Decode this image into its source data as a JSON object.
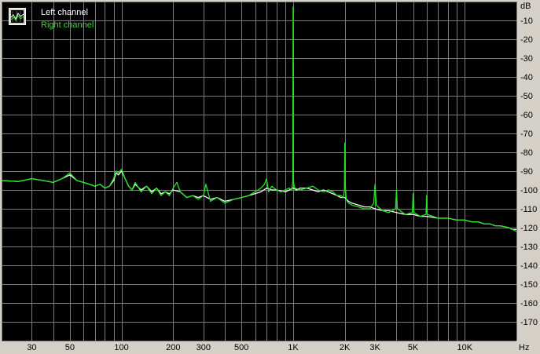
{
  "colors": {
    "background": "#000000",
    "frame": "#d4d0c8",
    "grid": "#7a7a7a",
    "left_channel": "#ffffff",
    "right_channel": "#22e622"
  },
  "legend": {
    "icon": "spectrum-icon",
    "placement": "top-left"
  },
  "chart_data": {
    "type": "line",
    "title": "",
    "xlabel": "",
    "ylabel": "",
    "x_unit": "Hz",
    "y_unit": "dB",
    "x_scale": "log",
    "xlim": [
      20,
      20000
    ],
    "ylim": [
      -180,
      0
    ],
    "grid": true,
    "x_ticks": [
      {
        "value": 30,
        "label": "30"
      },
      {
        "value": 50,
        "label": "50"
      },
      {
        "value": 100,
        "label": "100"
      },
      {
        "value": 200,
        "label": "200"
      },
      {
        "value": 300,
        "label": "300"
      },
      {
        "value": 500,
        "label": "500"
      },
      {
        "value": 1000,
        "label": "1K"
      },
      {
        "value": 2000,
        "label": "2K"
      },
      {
        "value": 3000,
        "label": "3K"
      },
      {
        "value": 5000,
        "label": "5K"
      },
      {
        "value": 10000,
        "label": "10K"
      }
    ],
    "y_ticks": [
      {
        "value": -10,
        "label": "-10"
      },
      {
        "value": -20,
        "label": "-20"
      },
      {
        "value": -30,
        "label": "-30"
      },
      {
        "value": -40,
        "label": "-40"
      },
      {
        "value": -50,
        "label": "-50"
      },
      {
        "value": -60,
        "label": "-60"
      },
      {
        "value": -70,
        "label": "-70"
      },
      {
        "value": -80,
        "label": "-80"
      },
      {
        "value": -90,
        "label": "-90"
      },
      {
        "value": -100,
        "label": "-100"
      },
      {
        "value": -110,
        "label": "-110"
      },
      {
        "value": -120,
        "label": "-120"
      },
      {
        "value": -130,
        "label": "-130"
      },
      {
        "value": -140,
        "label": "-140"
      },
      {
        "value": -150,
        "label": "-150"
      },
      {
        "value": -160,
        "label": "-160"
      },
      {
        "value": -170,
        "label": "-170"
      }
    ],
    "series": [
      {
        "name": "Left channel",
        "color": "#ffffff",
        "x": [
          20,
          25,
          30,
          35,
          40,
          45,
          50,
          55,
          60,
          65,
          70,
          75,
          80,
          85,
          90,
          93,
          96,
          100,
          105,
          110,
          115,
          120,
          130,
          140,
          150,
          160,
          170,
          180,
          190,
          200,
          220,
          240,
          260,
          280,
          300,
          330,
          360,
          400,
          450,
          500,
          550,
          600,
          650,
          700,
          750,
          800,
          900,
          950,
          1000,
          1050,
          1100,
          1200,
          1300,
          1400,
          1500,
          1600,
          1700,
          1800,
          1900,
          2000,
          2100,
          2200,
          2400,
          2600,
          2800,
          3000,
          3300,
          3600,
          4000,
          4500,
          5000,
          5500,
          6000,
          7000,
          8000,
          9000,
          10000,
          11000,
          12000,
          13000,
          14000,
          15000,
          16000,
          17000,
          18000,
          19000,
          20000
        ],
        "y": [
          -95,
          -95.5,
          -94,
          -95,
          -96,
          -94,
          -92,
          -95,
          -96,
          -97,
          -98,
          -97,
          -99,
          -98,
          -95,
          -91,
          -92,
          -90,
          -94,
          -98,
          -100,
          -97,
          -100,
          -98,
          -101,
          -99,
          -102,
          -101,
          -102,
          -100,
          -101,
          -104,
          -103,
          -104,
          -103,
          -105,
          -104,
          -106,
          -105,
          -104,
          -103,
          -102,
          -101,
          -99,
          -100,
          -100,
          -101,
          -100,
          -99,
          -100,
          -99,
          -99,
          -100,
          -101,
          -100,
          -101,
          -102,
          -103,
          -104,
          -104,
          -106,
          -107,
          -108,
          -109,
          -109,
          -110,
          -111,
          -111,
          -112,
          -113,
          -113,
          -114,
          -114,
          -115,
          -115,
          -116,
          -116,
          -117,
          -117,
          -118,
          -118,
          -119,
          -119,
          -119.5,
          -120,
          -121,
          -121
        ]
      },
      {
        "name": "Right channel",
        "color": "#22e622",
        "x": [
          20,
          25,
          30,
          35,
          40,
          45,
          50,
          55,
          60,
          65,
          70,
          75,
          80,
          85,
          90,
          93,
          96,
          100,
          105,
          110,
          115,
          120,
          130,
          140,
          150,
          160,
          170,
          180,
          190,
          200,
          210,
          220,
          240,
          260,
          280,
          300,
          310,
          330,
          360,
          400,
          450,
          500,
          550,
          600,
          650,
          680,
          700,
          720,
          750,
          800,
          850,
          900,
          950,
          980,
          995,
          1000,
          1005,
          1020,
          1100,
          1200,
          1300,
          1400,
          1500,
          1600,
          1700,
          1800,
          1900,
          1960,
          1990,
          2000,
          2010,
          2040,
          2100,
          2200,
          2400,
          2600,
          2800,
          2950,
          3000,
          3050,
          3300,
          3600,
          3950,
          4000,
          4050,
          4500,
          4950,
          5000,
          5050,
          5500,
          5950,
          6000,
          6050,
          7000,
          8000,
          9000,
          10000,
          11000,
          12000,
          13000,
          14000,
          15000,
          16000,
          17000,
          18000,
          19000,
          20000
        ],
        "y": [
          -95,
          -95.5,
          -94,
          -95,
          -96,
          -94,
          -91,
          -95,
          -96,
          -97,
          -98,
          -97,
          -99,
          -98,
          -94,
          -90,
          -91,
          -89,
          -94,
          -98,
          -100,
          -96,
          -101,
          -98,
          -102,
          -99,
          -103,
          -101,
          -103,
          -99,
          -96,
          -101,
          -104,
          -103,
          -105,
          -103,
          -97,
          -106,
          -104,
          -107,
          -105,
          -104,
          -103,
          -101,
          -99,
          -97,
          -94,
          -101,
          -98,
          -100,
          -101,
          -100,
          -99,
          -100,
          -96,
          -3,
          -96,
          -99,
          -100,
          -99,
          -98,
          -100,
          -101,
          -100,
          -101,
          -103,
          -103,
          -104,
          -100,
          -75,
          -96,
          -105,
          -107,
          -108,
          -109,
          -110,
          -110,
          -107,
          -97,
          -108,
          -111,
          -112,
          -110,
          -100,
          -110,
          -113,
          -112,
          -102,
          -112,
          -114,
          -113,
          -103,
          -113,
          -115,
          -115,
          -116,
          -116,
          -117,
          -117,
          -118,
          -118,
          -119,
          -119,
          -119.5,
          -120,
          -121,
          -122
        ]
      }
    ]
  }
}
